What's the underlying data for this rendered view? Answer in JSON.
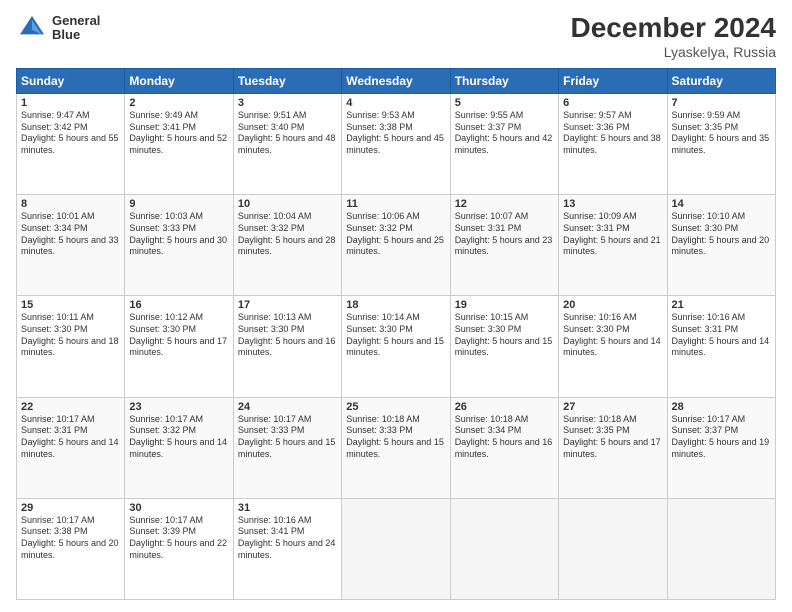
{
  "header": {
    "logo_line1": "General",
    "logo_line2": "Blue",
    "month": "December 2024",
    "location": "Lyaskelya, Russia"
  },
  "weekdays": [
    "Sunday",
    "Monday",
    "Tuesday",
    "Wednesday",
    "Thursday",
    "Friday",
    "Saturday"
  ],
  "weeks": [
    [
      {
        "day": "1",
        "sunrise": "Sunrise: 9:47 AM",
        "sunset": "Sunset: 3:42 PM",
        "daylight": "Daylight: 5 hours and 55 minutes."
      },
      {
        "day": "2",
        "sunrise": "Sunrise: 9:49 AM",
        "sunset": "Sunset: 3:41 PM",
        "daylight": "Daylight: 5 hours and 52 minutes."
      },
      {
        "day": "3",
        "sunrise": "Sunrise: 9:51 AM",
        "sunset": "Sunset: 3:40 PM",
        "daylight": "Daylight: 5 hours and 48 minutes."
      },
      {
        "day": "4",
        "sunrise": "Sunrise: 9:53 AM",
        "sunset": "Sunset: 3:38 PM",
        "daylight": "Daylight: 5 hours and 45 minutes."
      },
      {
        "day": "5",
        "sunrise": "Sunrise: 9:55 AM",
        "sunset": "Sunset: 3:37 PM",
        "daylight": "Daylight: 5 hours and 42 minutes."
      },
      {
        "day": "6",
        "sunrise": "Sunrise: 9:57 AM",
        "sunset": "Sunset: 3:36 PM",
        "daylight": "Daylight: 5 hours and 38 minutes."
      },
      {
        "day": "7",
        "sunrise": "Sunrise: 9:59 AM",
        "sunset": "Sunset: 3:35 PM",
        "daylight": "Daylight: 5 hours and 35 minutes."
      }
    ],
    [
      {
        "day": "8",
        "sunrise": "Sunrise: 10:01 AM",
        "sunset": "Sunset: 3:34 PM",
        "daylight": "Daylight: 5 hours and 33 minutes."
      },
      {
        "day": "9",
        "sunrise": "Sunrise: 10:03 AM",
        "sunset": "Sunset: 3:33 PM",
        "daylight": "Daylight: 5 hours and 30 minutes."
      },
      {
        "day": "10",
        "sunrise": "Sunrise: 10:04 AM",
        "sunset": "Sunset: 3:32 PM",
        "daylight": "Daylight: 5 hours and 28 minutes."
      },
      {
        "day": "11",
        "sunrise": "Sunrise: 10:06 AM",
        "sunset": "Sunset: 3:32 PM",
        "daylight": "Daylight: 5 hours and 25 minutes."
      },
      {
        "day": "12",
        "sunrise": "Sunrise: 10:07 AM",
        "sunset": "Sunset: 3:31 PM",
        "daylight": "Daylight: 5 hours and 23 minutes."
      },
      {
        "day": "13",
        "sunrise": "Sunrise: 10:09 AM",
        "sunset": "Sunset: 3:31 PM",
        "daylight": "Daylight: 5 hours and 21 minutes."
      },
      {
        "day": "14",
        "sunrise": "Sunrise: 10:10 AM",
        "sunset": "Sunset: 3:30 PM",
        "daylight": "Daylight: 5 hours and 20 minutes."
      }
    ],
    [
      {
        "day": "15",
        "sunrise": "Sunrise: 10:11 AM",
        "sunset": "Sunset: 3:30 PM",
        "daylight": "Daylight: 5 hours and 18 minutes."
      },
      {
        "day": "16",
        "sunrise": "Sunrise: 10:12 AM",
        "sunset": "Sunset: 3:30 PM",
        "daylight": "Daylight: 5 hours and 17 minutes."
      },
      {
        "day": "17",
        "sunrise": "Sunrise: 10:13 AM",
        "sunset": "Sunset: 3:30 PM",
        "daylight": "Daylight: 5 hours and 16 minutes."
      },
      {
        "day": "18",
        "sunrise": "Sunrise: 10:14 AM",
        "sunset": "Sunset: 3:30 PM",
        "daylight": "Daylight: 5 hours and 15 minutes."
      },
      {
        "day": "19",
        "sunrise": "Sunrise: 10:15 AM",
        "sunset": "Sunset: 3:30 PM",
        "daylight": "Daylight: 5 hours and 15 minutes."
      },
      {
        "day": "20",
        "sunrise": "Sunrise: 10:16 AM",
        "sunset": "Sunset: 3:30 PM",
        "daylight": "Daylight: 5 hours and 14 minutes."
      },
      {
        "day": "21",
        "sunrise": "Sunrise: 10:16 AM",
        "sunset": "Sunset: 3:31 PM",
        "daylight": "Daylight: 5 hours and 14 minutes."
      }
    ],
    [
      {
        "day": "22",
        "sunrise": "Sunrise: 10:17 AM",
        "sunset": "Sunset: 3:31 PM",
        "daylight": "Daylight: 5 hours and 14 minutes."
      },
      {
        "day": "23",
        "sunrise": "Sunrise: 10:17 AM",
        "sunset": "Sunset: 3:32 PM",
        "daylight": "Daylight: 5 hours and 14 minutes."
      },
      {
        "day": "24",
        "sunrise": "Sunrise: 10:17 AM",
        "sunset": "Sunset: 3:33 PM",
        "daylight": "Daylight: 5 hours and 15 minutes."
      },
      {
        "day": "25",
        "sunrise": "Sunrise: 10:18 AM",
        "sunset": "Sunset: 3:33 PM",
        "daylight": "Daylight: 5 hours and 15 minutes."
      },
      {
        "day": "26",
        "sunrise": "Sunrise: 10:18 AM",
        "sunset": "Sunset: 3:34 PM",
        "daylight": "Daylight: 5 hours and 16 minutes."
      },
      {
        "day": "27",
        "sunrise": "Sunrise: 10:18 AM",
        "sunset": "Sunset: 3:35 PM",
        "daylight": "Daylight: 5 hours and 17 minutes."
      },
      {
        "day": "28",
        "sunrise": "Sunrise: 10:17 AM",
        "sunset": "Sunset: 3:37 PM",
        "daylight": "Daylight: 5 hours and 19 minutes."
      }
    ],
    [
      {
        "day": "29",
        "sunrise": "Sunrise: 10:17 AM",
        "sunset": "Sunset: 3:38 PM",
        "daylight": "Daylight: 5 hours and 20 minutes."
      },
      {
        "day": "30",
        "sunrise": "Sunrise: 10:17 AM",
        "sunset": "Sunset: 3:39 PM",
        "daylight": "Daylight: 5 hours and 22 minutes."
      },
      {
        "day": "31",
        "sunrise": "Sunrise: 10:16 AM",
        "sunset": "Sunset: 3:41 PM",
        "daylight": "Daylight: 5 hours and 24 minutes."
      },
      null,
      null,
      null,
      null
    ]
  ]
}
